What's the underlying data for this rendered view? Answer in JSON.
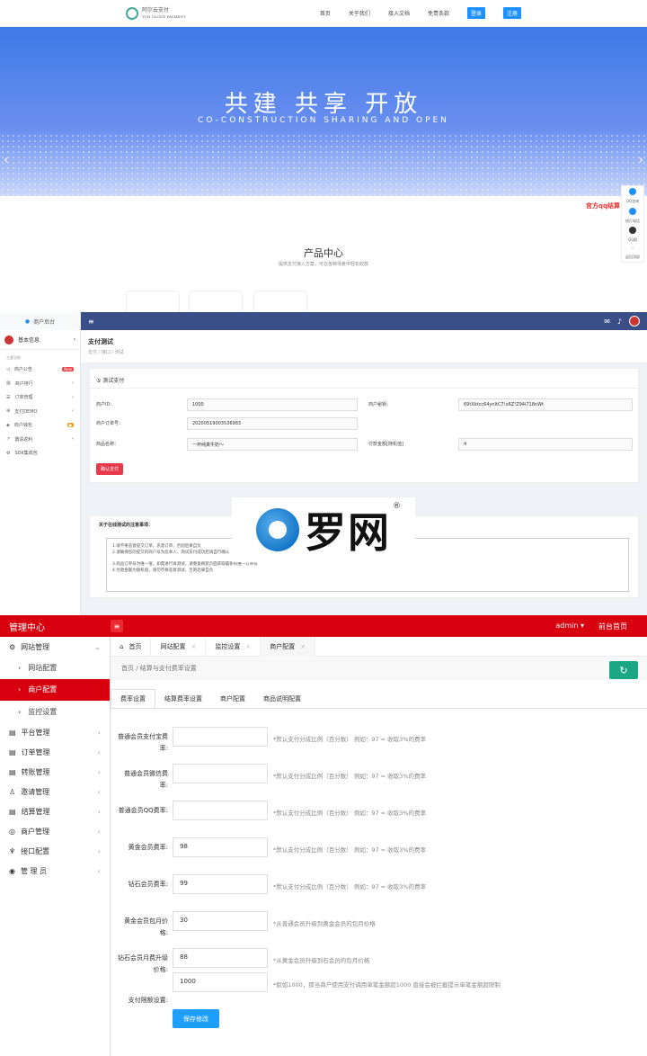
{
  "site": {
    "logo_text_1": "阿尔云支付",
    "logo_text_2": "YUN CLOUD PAYMENT",
    "nav": [
      "首页",
      "关于我们",
      "接入文档",
      "免责条款"
    ],
    "login": "登录",
    "register": "注册",
    "banner_title": "共建  共享  开放",
    "banner_sub": "CO-CONSTRUCTION SHARING AND OPEN",
    "float_items": [
      "QQ咨询",
      "拨打电话",
      "QQ群",
      "返回顶部"
    ],
    "qq_red": "官方qq结算",
    "product_title": "产品中心",
    "product_sub": "提供支付接入方案，可在各种场景中轻松收款"
  },
  "merchant": {
    "brand": "商户后台",
    "user_label": "基本信息",
    "nav_head": "主要导航",
    "nav": [
      {
        "label": "商户公告",
        "badge": "New"
      },
      {
        "label": "商户排行",
        "badge": ""
      },
      {
        "label": "订单管理",
        "badge": ""
      },
      {
        "label": "支付DEMO",
        "badge": ""
      },
      {
        "label": "商户钱包",
        "badge": "●"
      },
      {
        "label": "邀请返利",
        "badge": ""
      },
      {
        "label": "SDK集成包",
        "badge": ""
      }
    ],
    "page_title": "支付测试",
    "breadcrumb": "支付  /  接口  /  测试",
    "card_title": "⑤ 测试支付",
    "fields": {
      "pid_label": "商户ID：",
      "pid_value": "1000",
      "key_label": "商户秘钥：",
      "key_value": "69tXktcc64ynltC7!x6Z!Z94i718nWt",
      "order_label": "商户订单号：",
      "order_value": "20200519003536983",
      "name_label": "商品名称：",
      "name_value": "一杯纯真牛奶～",
      "amount_label": "付款金额[随机值]",
      "amount_value": "4"
    },
    "pay_button": "确认支付",
    "notice_title": "关于在线测试的注意事项：",
    "notes": [
      "1.请不要恶意提交订单，恶意订单，否则后果自负",
      "2.请确保您的提交的商户号为您本人，测试支付成功后请自行确认",
      "3.商品订单号为唯一值，如需进行再测试，请重复刷新页面获取最新的唯一订单号",
      "4.付款金额为随机值，请勿不要恶意测试，否则后果自负"
    ],
    "watermark": "罗网",
    "watermark_reg": "®"
  },
  "admin": {
    "title": "管理中心",
    "user": "admin",
    "front": "前台首页",
    "menu": [
      {
        "label": "网站管理",
        "expanded": true
      },
      {
        "label": "平台管理"
      },
      {
        "label": "订单管理"
      },
      {
        "label": "转账管理"
      },
      {
        "label": "邀请管理"
      },
      {
        "label": "结算管理"
      },
      {
        "label": "商户管理"
      },
      {
        "label": "接口配置"
      },
      {
        "label": "管 理 员"
      }
    ],
    "submenu": [
      "网站配置",
      "商户配置",
      "监控设置"
    ],
    "tabs": [
      "首页",
      "网站配置",
      "监控设置",
      "商户配置"
    ],
    "breadcrumb": "首页  /  结算与支付费率设置",
    "refresh_icon": "refresh-icon",
    "sub_tabs": [
      "费率设置",
      "结算费率设置",
      "商户配置",
      "商品说明配置"
    ],
    "form": [
      {
        "label": "普通会员支付宝费率:",
        "value": "",
        "tip": "*默认支付分成比例（百分数） 例如：97 = 收取3%的费率"
      },
      {
        "label": "普通会员微信费率:",
        "value": "",
        "tip": "*默认支付分成比例（百分数） 例如：97 = 收取3%的费率"
      },
      {
        "label": "普通会员QQ费率:",
        "value": "",
        "tip": "*默认支付分成比例（百分数） 例如：97 = 收取3%的费率"
      },
      {
        "label": "黄金会员费率:",
        "value": "98",
        "tip": "*默认支付分成比例（百分数） 例如：97 = 收取3%的费率"
      },
      {
        "label": "钻石会员费率:",
        "value": "99",
        "tip": "*默认支付分成比例（百分数） 例如：97 = 收取3%的费率"
      },
      {
        "label": "黄金会员包月价格:",
        "value": "30",
        "tip": "*从普通会员升级到黄金会员的包月价格"
      },
      {
        "label": "钻石会员月费升级价格:",
        "value": "88",
        "tip": "*从黄金会员升级到石会员的包月价格"
      },
      {
        "label": "支付限额设置:",
        "value": "1000",
        "tip": "*假如1000，那当商户使用支付调用单笔金额超1000 直接会被拦截提示单笔金额超限制"
      }
    ],
    "save": "保存修改"
  }
}
